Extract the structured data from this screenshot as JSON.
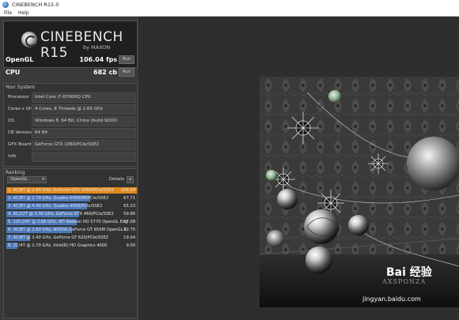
{
  "window": {
    "title": "CINEBENCH R15.0"
  },
  "menu": [
    {
      "label": "File"
    },
    {
      "label": "Help"
    }
  ],
  "logo": {
    "title": "CINEBENCH R15",
    "subtitle": "by MAXON"
  },
  "scores": {
    "opengl": {
      "label": "OpenGL",
      "value": "106.04 fps",
      "run": "Run"
    },
    "cpu": {
      "label": "CPU",
      "value": "682 cb",
      "run": "Run"
    }
  },
  "system": {
    "title": "Your System",
    "rows": [
      {
        "key": "Processor",
        "value": "Intel Core i7-6700HQ CPU"
      },
      {
        "key": "Cores x GHz",
        "value": "4 Cores, 8 Threads @ 2.60 GHz"
      },
      {
        "key": "OS",
        "value": "Windows 8, 64 Bit, China (build 9200)"
      },
      {
        "key": "CB Version",
        "value": "64 Bit"
      },
      {
        "key": "GFX Board",
        "value": "GeForce GTX 1060/PCIe/SSE2"
      },
      {
        "key": "Info",
        "value": ""
      }
    ]
  },
  "ranking": {
    "title": "Ranking",
    "selected": "OpenGL",
    "details_label": "Details",
    "details_btn": "+",
    "rows": [
      {
        "text": "1. 4C/8T @ 2.60 GHz, GeForce GTX 1060/PCIe/SSE2",
        "score": "106.04",
        "fraction": 1.0,
        "highlight": true
      },
      {
        "text": "2. 4C/8T @ 2.79 GHz, Quadro K4000M/PCIe/SSE2",
        "score": "67.71",
        "fraction": 0.64,
        "highlight": false
      },
      {
        "text": "3. 4C/8T @ 4.40 GHz, Quadro 4000/PCIe/SSE2",
        "score": "65.33",
        "fraction": 0.62,
        "highlight": false
      },
      {
        "text": "4. 6C/12T @ 3.30 GHz, GeForce GTX 460/PCIe/SSE2",
        "score": "59.86",
        "fraction": 0.56,
        "highlight": false
      },
      {
        "text": "5. 12C/24T @ 2.66 GHz, ATI Radeon HD 5770 OpenGL Eng",
        "score": "57.08",
        "fraction": 0.54,
        "highlight": false
      },
      {
        "text": "6. 4C/8T @ 2.60 GHz, NVIDIA GeForce GT 650M OpenGL E",
        "score": "52.75",
        "fraction": 0.5,
        "highlight": false
      },
      {
        "text": "7. 4C/8T @ 3.40 GHz, GeForce GT 620/PCIe/SSE2",
        "score": "19.04",
        "fraction": 0.18,
        "highlight": false
      },
      {
        "text": "8. 2C/4T @ 1.70 GHz, Intel(R) HD Graphics 4000",
        "score": "9.00",
        "fraction": 0.085,
        "highlight": false
      }
    ]
  },
  "render": {
    "watermark_brand": "AXSPONZA",
    "watermark_site": "jingyan.baidu.com",
    "watermark_logo": "Bai 经验"
  }
}
